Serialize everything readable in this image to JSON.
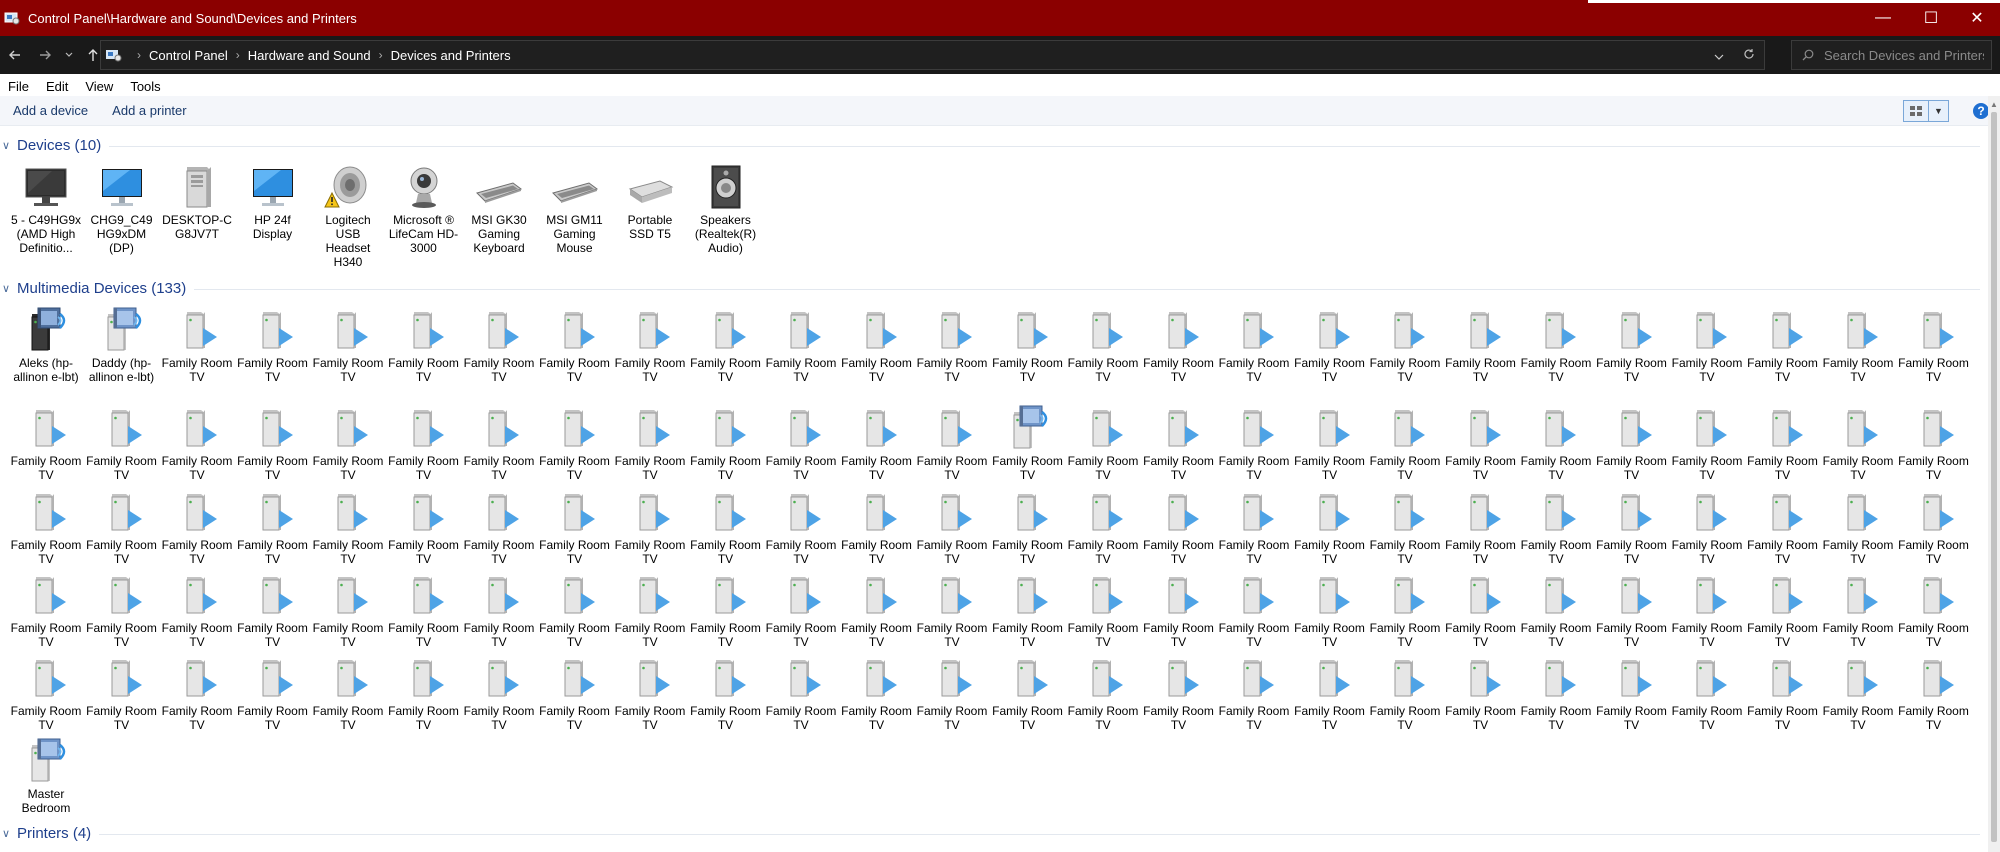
{
  "window": {
    "title": "Control Panel\\Hardware and Sound\\Devices and Printers",
    "minimize": "—",
    "maximize": "☐",
    "close": "✕",
    "accent_color": "#8b0000"
  },
  "address": {
    "crumbs": [
      "Control Panel",
      "Hardware and Sound",
      "Devices and Printers"
    ],
    "search_placeholder": "Search Devices and Printers"
  },
  "menu": {
    "items": [
      "File",
      "Edit",
      "View",
      "Tools"
    ]
  },
  "commands": {
    "add_device": "Add a device",
    "add_printer": "Add a printer",
    "help": "?"
  },
  "groups": {
    "devices": "Devices (10)",
    "multimedia": "Multimedia Devices (133)",
    "printers": "Printers (4)"
  },
  "devices": [
    {
      "label": "5 - C49HG9x (AMD High Definitio...",
      "icon": "monitor-dark-icon"
    },
    {
      "label": "CHG9_C49 HG9xDM (DP)",
      "icon": "monitor-blue-icon"
    },
    {
      "label": "DESKTOP-C G8JV7T",
      "icon": "desktop-tower-icon"
    },
    {
      "label": "HP 24f Display",
      "icon": "monitor-blue-icon"
    },
    {
      "label": "Logitech USB Headset H340",
      "icon": "speaker-warning-icon"
    },
    {
      "label": "Microsoft ® LifeCam HD-3000",
      "icon": "webcam-icon"
    },
    {
      "label": "MSI GK30 Gaming Keyboard",
      "icon": "keyboard-icon"
    },
    {
      "label": "MSI GM11 Gaming Mouse",
      "icon": "keyboard-icon"
    },
    {
      "label": "Portable SSD T5",
      "icon": "drive-icon"
    },
    {
      "label": "Speakers (Realtek(R) Audio)",
      "icon": "speaker-icon"
    }
  ],
  "multimedia_special": [
    {
      "index": 0,
      "label": "Aleks (hp-allinon e-lbt)",
      "icon": "media-server-dark-icon"
    },
    {
      "index": 1,
      "label": "Daddy (hp-allinon e-lbt)",
      "icon": "media-server-icon"
    },
    {
      "index": 39,
      "label": "Family Room TV",
      "icon": "media-server-icon"
    },
    {
      "index": 130,
      "label": "Master Bedroom",
      "icon": "media-server-icon"
    }
  ],
  "multimedia_default": {
    "label": "Family Room TV",
    "icon": "media-renderer-icon"
  },
  "multimedia_count": 131
}
